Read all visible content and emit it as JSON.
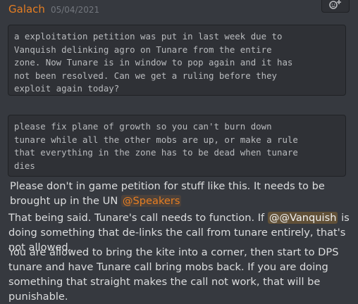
{
  "message": {
    "author": "Galach",
    "timestamp": "05/04/2021"
  },
  "toolbar": {
    "add_reaction_icon": "add-reaction-icon"
  },
  "codeblocks": [
    "a exploitation petition was put in last week due to\nVanquish delinking agro on Tunare from the entire\nzone. Now Tunare is in window to pop again and it has\nnot been resolved. Can we get a ruling before they\nexploit again today?",
    "please fix plane of growth so you can't burn down\ntunare while all the other mobs are up, or make a rule\nthat everything in the zone has to be dead when tunare\ndies"
  ],
  "replies": {
    "line1_text": "Please don't in game petition for stuff like this. It needs to be brought up in the UN ",
    "line1_mention": "@Speakers",
    "line2_before": "That being said. Tunare's call needs to function. If ",
    "line2_mention": "@@Vanquish",
    "line2_after": " is doing something that de-links the call from tunare entirely, that's not allowed.",
    "line3_text": "You are allowed to bring the kite into a corner, then start to DPS tunare and have Tunare call bring mobs back. If you are doing something that straight makes the call not work, that will be punishable."
  },
  "colors": {
    "background": "#36393f",
    "author": "#e67e22",
    "codeblock_bg": "#2f3136"
  }
}
